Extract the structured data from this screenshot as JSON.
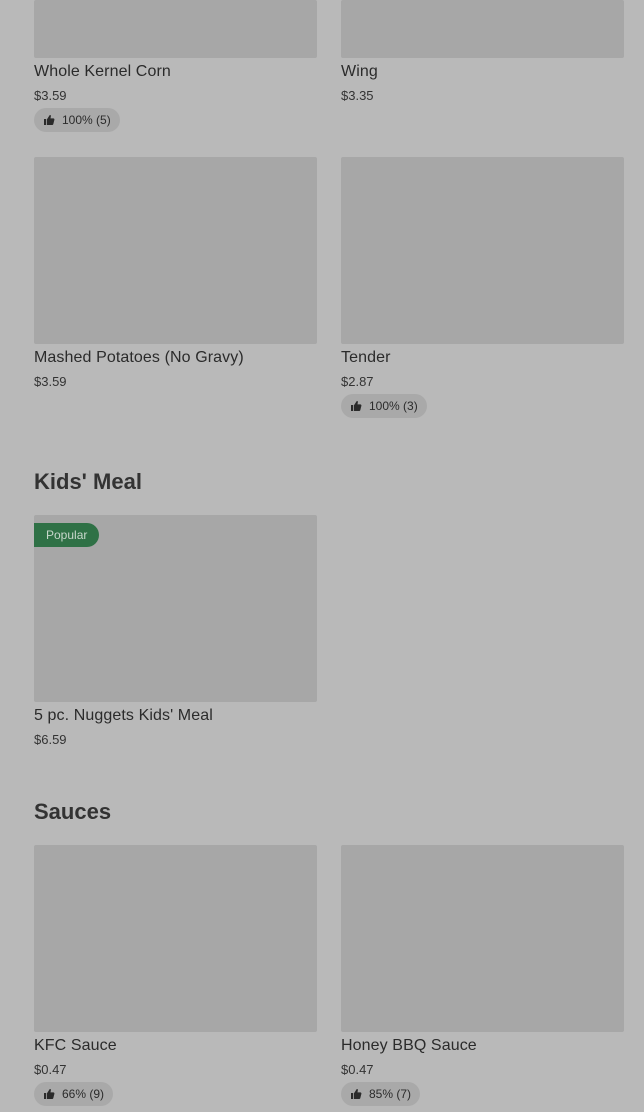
{
  "sides": {
    "items": [
      {
        "name": "Whole Kernel Corn",
        "price": "$3.59",
        "rating": "100% (5)"
      },
      {
        "name": "Wing",
        "price": "$3.35"
      },
      {
        "name": "Mashed Potatoes (No Gravy)",
        "price": "$3.59"
      },
      {
        "name": "Tender",
        "price": "$2.87",
        "rating": "100% (3)"
      }
    ]
  },
  "kids_meal": {
    "title": "Kids' Meal",
    "items": [
      {
        "badge": "Popular",
        "name": "5 pc. Nuggets Kids' Meal",
        "price": "$6.59"
      }
    ]
  },
  "sauces": {
    "title": "Sauces",
    "items": [
      {
        "name": "KFC Sauce",
        "price": "$0.47",
        "rating": "66% (9)"
      },
      {
        "name": "Honey BBQ Sauce",
        "price": "$0.47",
        "rating": "85% (7)"
      }
    ]
  },
  "icons": {
    "rating": "thumbs-up-icon"
  },
  "colors": {
    "overlay_background": "#b9b9b9",
    "image_placeholder": "#a7a7a7",
    "popular_badge": "#2f7146"
  }
}
